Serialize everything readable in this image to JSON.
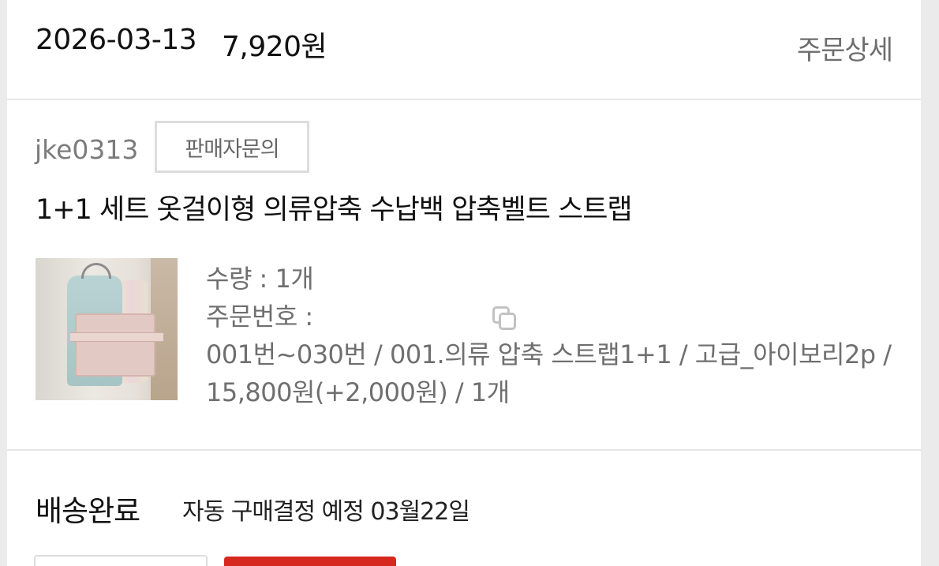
{
  "order": {
    "date": "2026-03-13",
    "amount": "7,920원",
    "detail_link": "주문상세"
  },
  "seller": {
    "id": "jke0313",
    "inquiry_button": "판매자문의"
  },
  "product": {
    "name": "1+1 세트 옷걸이형 의류압축 수납백 압축벨트 스트랩",
    "quantity_label": "수량 : 1개",
    "order_number_label": "주문번호 : ",
    "option": "001번~030번 / 001.의류 압축 스트랩1+1 / 고급_아이보리2p / 15,800원(+2,000원) / 1개"
  },
  "delivery": {
    "status": "배송완료",
    "note": "자동 구매결정 예정 03월22일"
  },
  "colors": {
    "accent": "#d7281f",
    "divider": "#e6e6e6",
    "muted_text": "#6f6f6f"
  }
}
